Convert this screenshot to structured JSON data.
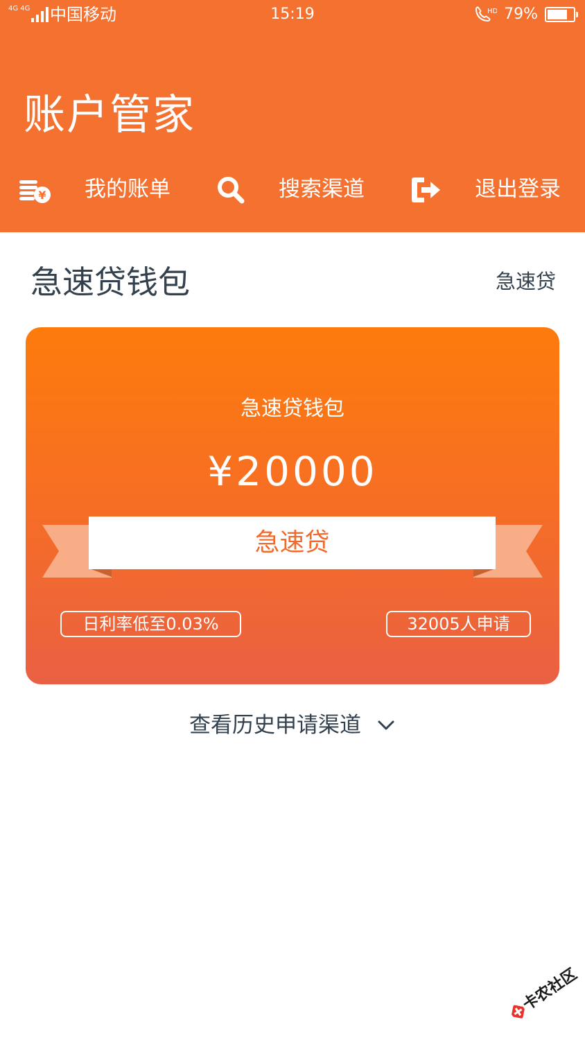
{
  "status_bar": {
    "network": "4G 4G",
    "carrier": "中国移动",
    "time": "15:19",
    "call_indicator": "HD",
    "battery_percent": "79%",
    "battery_level": 0.79,
    "icons": [
      "signal-bars-icon",
      "hd-call-icon",
      "battery-icon"
    ]
  },
  "header": {
    "title": "账户管家",
    "background_color": "#f47130",
    "nav": [
      {
        "label": "我的账单",
        "icon": "bill-coins-icon"
      },
      {
        "label": "搜索渠道",
        "icon": "search-icon"
      },
      {
        "label": "退出登录",
        "icon": "logout-icon"
      }
    ]
  },
  "section": {
    "title": "急速贷钱包",
    "link_label": "急速贷"
  },
  "card": {
    "title": "急速贷钱包",
    "amount": "¥20000",
    "button_label": "急速贷",
    "tags": {
      "rate": "日利率低至0.03%",
      "applicants": "32005人申请"
    },
    "gradient": [
      "#fd7b0c",
      "#ea6043"
    ]
  },
  "history": {
    "label": "查看历史申请渠道",
    "icon": "chevron-down-icon"
  },
  "watermark": {
    "text": "卡农社区",
    "logo_color": "#e8322b"
  }
}
